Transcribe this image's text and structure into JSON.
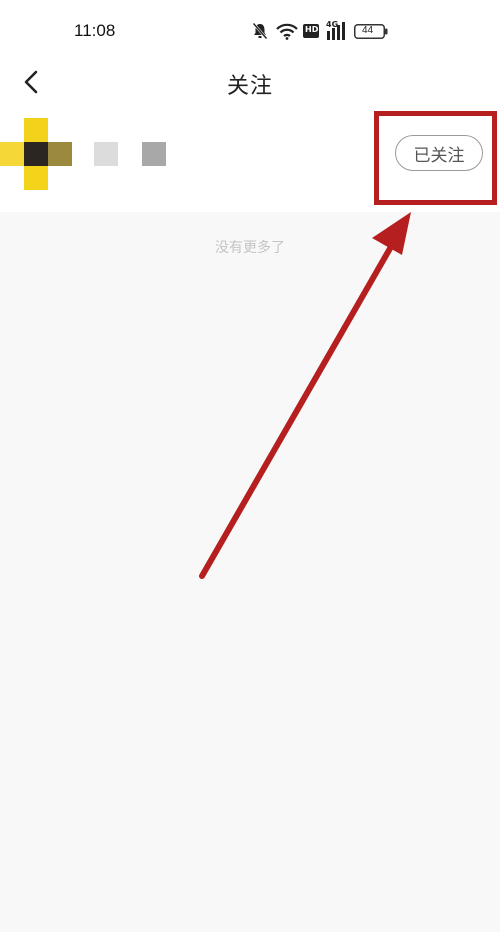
{
  "status_bar": {
    "time": "11:08",
    "network_label": "4G",
    "hd_label": "HD",
    "battery": "44"
  },
  "nav": {
    "title": "关注"
  },
  "follow_list": {
    "items": [
      {
        "follow_button_label": "已关注"
      }
    ],
    "end_text": "没有更多了"
  },
  "colors": {
    "highlight": "#b51f1f",
    "page_background": "#f8f8f8",
    "avatar_yellow": "#f2d21b"
  }
}
